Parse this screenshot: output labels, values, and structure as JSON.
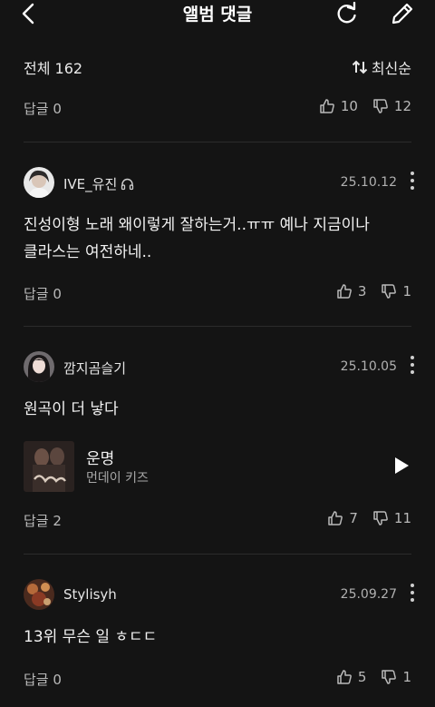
{
  "header": {
    "title": "앨범 댓글"
  },
  "summary": {
    "total_label": "전체 162",
    "sort_label": "최신순"
  },
  "top_actions": {
    "reply": "답글 0",
    "likes": "10",
    "dislikes": "12"
  },
  "comments": [
    {
      "username": "IVE_유진",
      "date": "25.10.12",
      "text_line1": "진성이형 노래 왜이렇게 잘하는거..ㅠㅠ 예나 지금이나",
      "text_line2": "클라스는 여전하네..",
      "reply": "답글 0",
      "likes": "3",
      "dislikes": "1"
    },
    {
      "username": "깜지곰슬기",
      "date": "25.10.05",
      "text_line1": "원곡이 더 낳다",
      "track": {
        "title": "운명",
        "artist": "먼데이 키즈"
      },
      "reply": "답글 2",
      "likes": "7",
      "dislikes": "11"
    },
    {
      "username": "Stylisyh",
      "date": "25.09.27",
      "text_line1": "13위 무슨 일 ㅎㄷㄷ",
      "reply": "답글 0",
      "likes": "5",
      "dislikes": "1"
    }
  ],
  "colors": {
    "background": "#141414",
    "text": "#ffffff",
    "muted": "#b9b9b9",
    "divider": "#2c2c2c"
  }
}
